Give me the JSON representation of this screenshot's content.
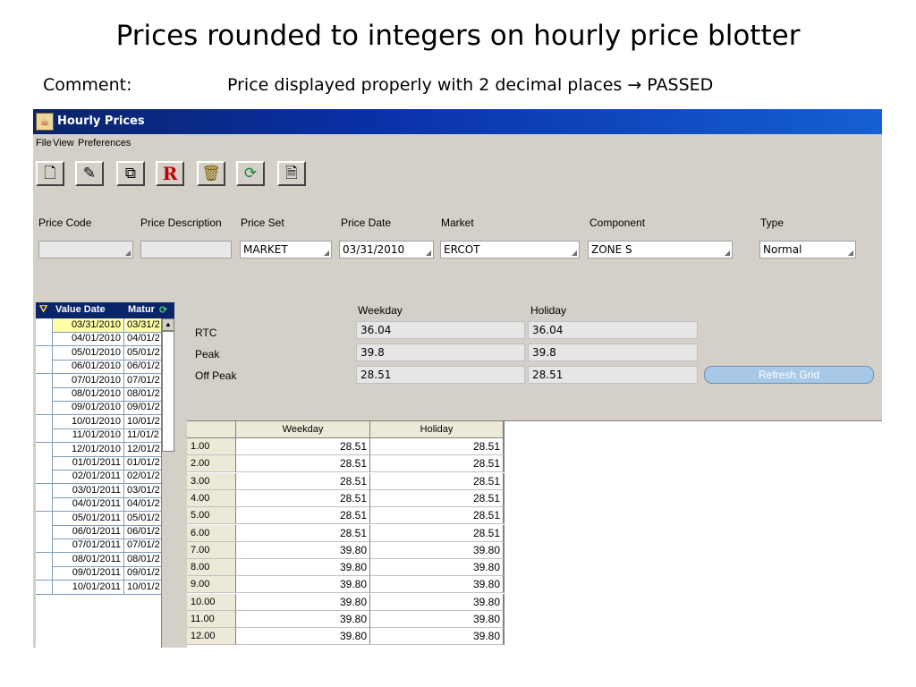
{
  "slide": {
    "title": "Prices rounded to integers on hourly price blotter",
    "comment_label": "Comment:",
    "comment_text": "Price displayed properly with 2 decimal places → PASSED"
  },
  "window": {
    "title": "Hourly Prices",
    "icon": "java-cup-icon"
  },
  "menu": [
    "File",
    "View",
    "Preferences"
  ],
  "toolbar": {
    "buttons": [
      {
        "name": "new-document-icon",
        "glyph": "🗋"
      },
      {
        "name": "edit-document-icon",
        "glyph": "✎"
      },
      {
        "name": "copy-document-icon",
        "glyph": "⧉"
      },
      {
        "name": "r-report-icon",
        "glyph": "R"
      },
      {
        "name": "trash-bin-icon",
        "glyph": "🗑"
      },
      {
        "name": "refresh-arrows-icon",
        "glyph": "⟳"
      },
      {
        "name": "notes-document-icon",
        "glyph": "🗎"
      }
    ]
  },
  "filters": {
    "price_code": {
      "label": "Price Code",
      "value": ""
    },
    "price_description": {
      "label": "Price Description",
      "value": ""
    },
    "price_set": {
      "label": "Price Set",
      "value": "MARKET"
    },
    "price_date": {
      "label": "Price Date",
      "value": "03/31/2010"
    },
    "market": {
      "label": "Market",
      "value": "ERCOT"
    },
    "component": {
      "label": "Component",
      "value": "ZONE S"
    },
    "type": {
      "label": "Type",
      "value": "Normal"
    }
  },
  "date_list": {
    "headers": [
      "Value Date",
      "Matur"
    ],
    "rows": [
      [
        "03/31/2010",
        "03/31/2"
      ],
      [
        "04/01/2010",
        "04/01/2"
      ],
      [
        "05/01/2010",
        "05/01/2"
      ],
      [
        "06/01/2010",
        "06/01/2"
      ],
      [
        "07/01/2010",
        "07/01/2"
      ],
      [
        "08/01/2010",
        "08/01/2"
      ],
      [
        "09/01/2010",
        "09/01/2"
      ],
      [
        "10/01/2010",
        "10/01/2"
      ],
      [
        "11/01/2010",
        "11/01/2"
      ],
      [
        "12/01/2010",
        "12/01/2"
      ],
      [
        "01/01/2011",
        "01/01/2"
      ],
      [
        "02/01/2011",
        "02/01/2"
      ],
      [
        "03/01/2011",
        "03/01/2"
      ],
      [
        "04/01/2011",
        "04/01/2"
      ],
      [
        "05/01/2011",
        "05/01/2"
      ],
      [
        "06/01/2011",
        "06/01/2"
      ],
      [
        "07/01/2011",
        "07/01/2"
      ],
      [
        "08/01/2011",
        "08/01/2"
      ],
      [
        "09/01/2011",
        "09/01/2"
      ],
      [
        "10/01/2011",
        "10/01/2"
      ]
    ]
  },
  "summary": {
    "col_weekday": "Weekday",
    "col_holiday": "Holiday",
    "rows": [
      {
        "label": "RTC",
        "weekday": "36.04",
        "holiday": "36.04"
      },
      {
        "label": "Peak",
        "weekday": "39.8",
        "holiday": "39.8"
      },
      {
        "label": "Off Peak",
        "weekday": "28.51",
        "holiday": "28.51"
      }
    ],
    "refresh_label": "Refresh Grid"
  },
  "grid": {
    "headers": [
      "Weekday",
      "Holiday"
    ],
    "rows": [
      {
        "hour": "1.00",
        "weekday": "28.51",
        "holiday": "28.51"
      },
      {
        "hour": "2.00",
        "weekday": "28.51",
        "holiday": "28.51"
      },
      {
        "hour": "3.00",
        "weekday": "28.51",
        "holiday": "28.51"
      },
      {
        "hour": "4.00",
        "weekday": "28.51",
        "holiday": "28.51"
      },
      {
        "hour": "5.00",
        "weekday": "28.51",
        "holiday": "28.51"
      },
      {
        "hour": "6.00",
        "weekday": "28.51",
        "holiday": "28.51"
      },
      {
        "hour": "7.00",
        "weekday": "39.80",
        "holiday": "39.80"
      },
      {
        "hour": "8.00",
        "weekday": "39.80",
        "holiday": "39.80"
      },
      {
        "hour": "9.00",
        "weekday": "39.80",
        "holiday": "39.80"
      },
      {
        "hour": "10.00",
        "weekday": "39.80",
        "holiday": "39.80"
      },
      {
        "hour": "11.00",
        "weekday": "39.80",
        "holiday": "39.80"
      },
      {
        "hour": "12.00",
        "weekday": "39.80",
        "holiday": "39.80"
      }
    ]
  },
  "colors": {
    "titlebar": "#0a246a",
    "selected_row": "#ffffa8",
    "refresh_button": "#a8c8e8"
  }
}
